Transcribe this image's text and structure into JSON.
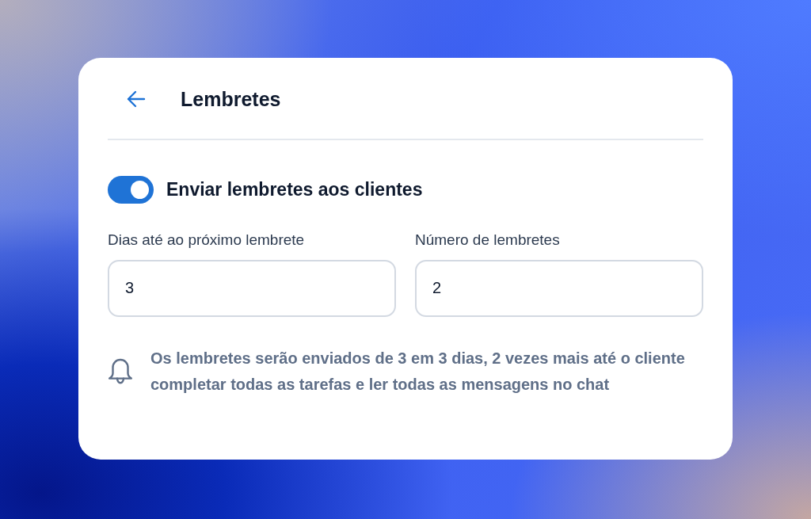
{
  "header": {
    "title": "Lembretes"
  },
  "toggle": {
    "label": "Enviar lembretes aos clientes",
    "on": true
  },
  "fields": [
    {
      "label": "Dias até ao próximo lembrete",
      "value": "3"
    },
    {
      "label": "Número de lembretes",
      "value": "2"
    }
  ],
  "note": {
    "text": "Os lembretes serão enviados de 3 em 3 dias, 2 vezes mais até o cliente completar todas as tarefas e ler todas as mensagens no chat"
  }
}
